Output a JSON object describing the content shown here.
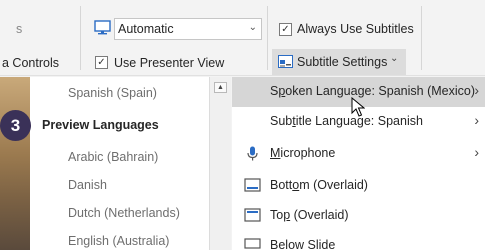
{
  "ribbon": {
    "left_partial_top": "s",
    "left_partial_bottom": "a Controls",
    "monitor_dropdown_value": "Automatic",
    "use_presenter_view_label": "Use Presenter View",
    "use_presenter_view_checked": true,
    "always_use_subtitles_label": "Always Use Subtitles",
    "always_use_subtitles_checked": true,
    "subtitle_settings_label": "Subtitle Settings",
    "check_mark": "✓",
    "dropdown_chevron": "⌄"
  },
  "step_badge": "3",
  "languages": {
    "top_item": "Spanish (Spain)",
    "section_heading": "Preview Languages",
    "items": [
      "Arabic (Bahrain)",
      "Danish",
      "Dutch (Netherlands)",
      "English (Australia)"
    ]
  },
  "submenu": {
    "spoken_prefix": "S",
    "spoken_access": "p",
    "spoken_suffix": "oken Language: Spanish (Mexico)",
    "subtitle_prefix": "Sub",
    "subtitle_access": "t",
    "subtitle_suffix": "itle Language: Spanish",
    "microphone_access": "M",
    "microphone_suffix": "icrophone",
    "bottom_prefix": "Bott",
    "bottom_access": "o",
    "bottom_suffix": "m (Overlaid)",
    "top_prefix": "To",
    "top_access": "p",
    "top_suffix": " (Overlaid)",
    "below_slide": "Below Slide",
    "arrow_glyph": "›"
  },
  "colors": {
    "accent_blue": "#2b6cc4",
    "badge": "#3a3158",
    "highlight": "#d6d6d6"
  }
}
